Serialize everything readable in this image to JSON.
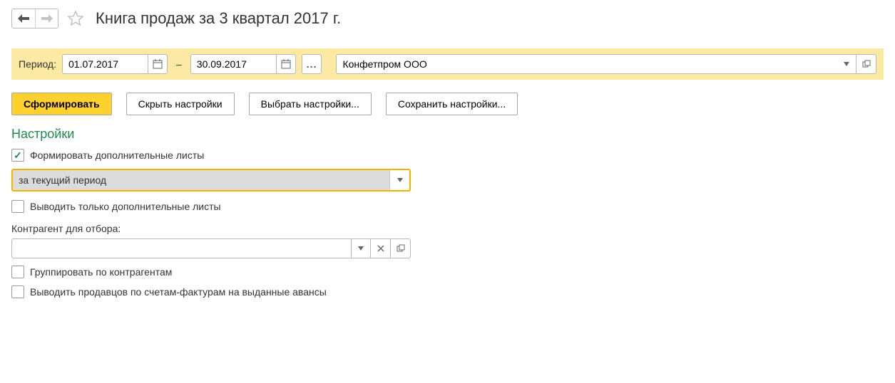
{
  "header": {
    "title": "Книга продаж за 3 квартал 2017 г."
  },
  "period": {
    "label": "Период:",
    "from": "01.07.2017",
    "to": "30.09.2017",
    "organization": "Конфетпром ООО"
  },
  "toolbar": {
    "generate": "Сформировать",
    "hide_settings": "Скрыть настройки",
    "choose_settings": "Выбрать настройки...",
    "save_settings": "Сохранить настройки..."
  },
  "settings": {
    "heading": "Настройки",
    "form_additional_sheets": {
      "label": "Формировать дополнительные листы",
      "checked": true
    },
    "period_mode": {
      "value": "за текущий период"
    },
    "only_additional_sheets": {
      "label": "Выводить только дополнительные листы",
      "checked": false
    },
    "counterparty": {
      "label": "Контрагент для отбора:",
      "value": ""
    },
    "group_by_counterparty": {
      "label": "Группировать по контрагентам",
      "checked": false
    },
    "show_advance_sellers": {
      "label": "Выводить продавцов по счетам-фактурам на выданные авансы",
      "checked": false
    }
  }
}
